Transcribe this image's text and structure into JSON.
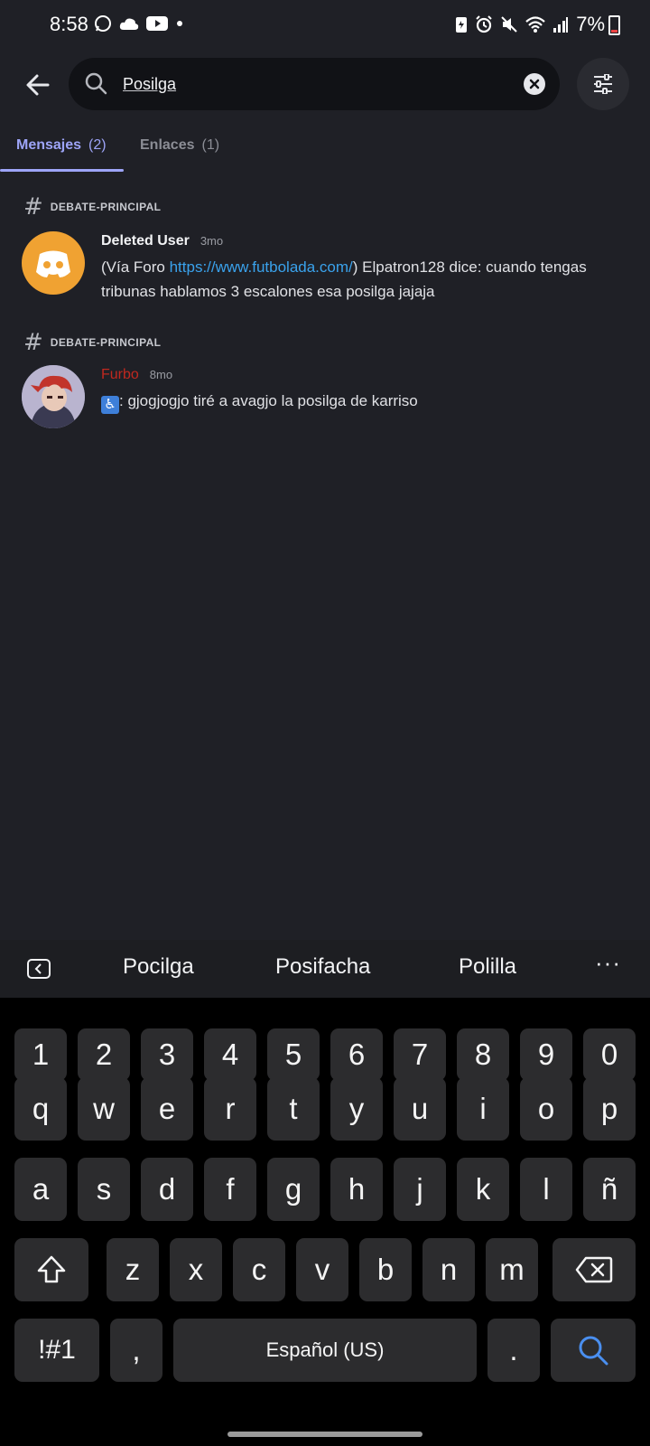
{
  "status_bar": {
    "time": "8:58",
    "battery_text": "7%"
  },
  "search": {
    "query": "Posilga"
  },
  "tabs": [
    {
      "label": "Mensajes",
      "count": "(2)"
    },
    {
      "label": "Enlaces",
      "count": "(1)"
    }
  ],
  "results": [
    {
      "channel": "DEBATE-PRINCIPAL",
      "author": "Deleted User",
      "time": "3mo",
      "text_before": "(Vía Foro ",
      "link": "https://www.futbolada.com/",
      "text_after": ") Elpatron128 dice: cuando tengas tribunas hablamos 3 escalones esa posilga jajaja"
    },
    {
      "channel": "DEBATE-PRINCIPAL",
      "author": "Furbo",
      "time": "8mo",
      "text_after": ": gjogjogjo tiré a avagjo la posilga de karriso"
    }
  ],
  "keyboard": {
    "suggestions": [
      "Pocilga",
      "Posifacha",
      "Polilla"
    ],
    "more": "···",
    "row_numbers": [
      "1",
      "2",
      "3",
      "4",
      "5",
      "6",
      "7",
      "8",
      "9",
      "0"
    ],
    "row1": [
      "q",
      "w",
      "e",
      "r",
      "t",
      "y",
      "u",
      "i",
      "o",
      "p"
    ],
    "row2": [
      "a",
      "s",
      "d",
      "f",
      "g",
      "h",
      "j",
      "k",
      "l",
      "ñ"
    ],
    "row3": [
      "z",
      "x",
      "c",
      "v",
      "b",
      "n",
      "m"
    ],
    "symbols_label": "!#1",
    "comma": ",",
    "space_label": "Español (US)",
    "period": "."
  },
  "colors": {
    "accent": "#9da4f7",
    "link": "#3aa2ec",
    "background": "#1f2026"
  }
}
